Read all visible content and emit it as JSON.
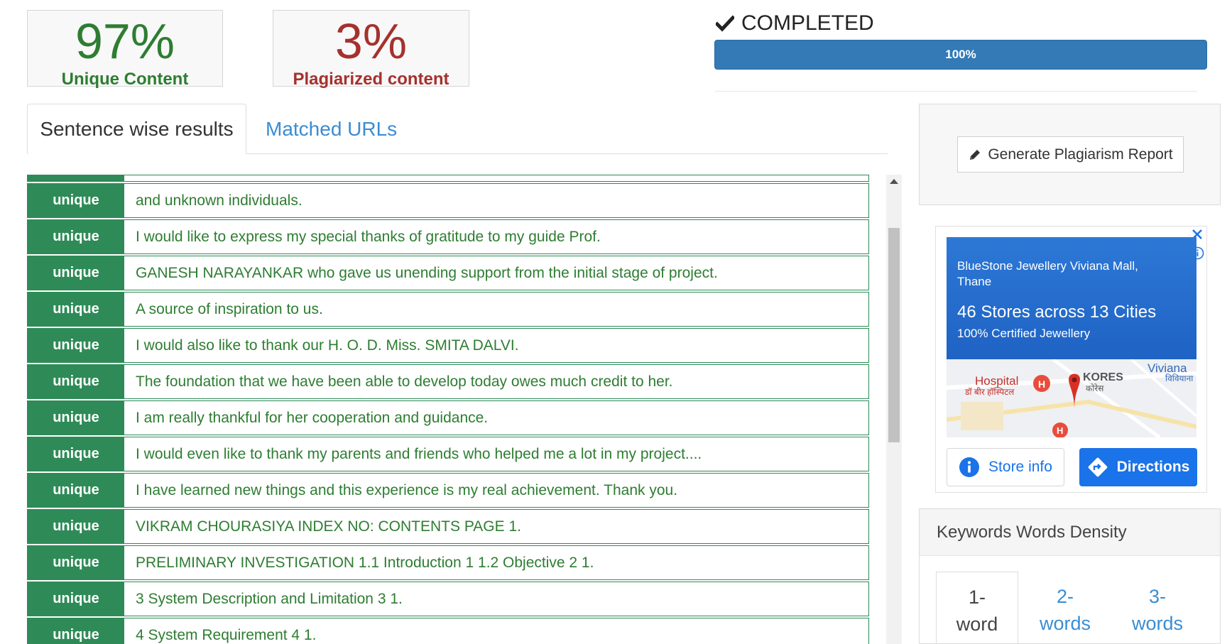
{
  "scores": {
    "unique": {
      "value": "97%",
      "label": "Unique Content",
      "color": "#2e7d32"
    },
    "plagiarized": {
      "value": "3%",
      "label": "Plagiarized content",
      "color": "#a5312d"
    }
  },
  "status": {
    "text": "COMPLETED",
    "icon": "check-icon"
  },
  "progress": {
    "percent": 100,
    "label": "100%",
    "color": "#337ab7"
  },
  "tabs": [
    {
      "label": "Sentence wise results",
      "active": true
    },
    {
      "label": "Matched URLs",
      "active": false
    }
  ],
  "results": [
    {
      "status": "unique",
      "text": "and unknown individuals."
    },
    {
      "status": "unique",
      "text": "I would like to express my special thanks of gratitude to my guide Prof."
    },
    {
      "status": "unique",
      "text": "GANESH NARAYANKAR who gave us unending support from the initial stage of project."
    },
    {
      "status": "unique",
      "text": "A source of inspiration to us."
    },
    {
      "status": "unique",
      "text": "I would also like to thank our H. O. D. Miss. SMITA DALVI."
    },
    {
      "status": "unique",
      "text": "The foundation that we have been able to develop today owes much credit to her."
    },
    {
      "status": "unique",
      "text": "I am really thankful for her cooperation and guidance."
    },
    {
      "status": "unique",
      "text": "I would even like to thank my parents and friends who helped me a lot in my project...."
    },
    {
      "status": "unique",
      "text": "I have learned new things and this experience is my real achievement. Thank you."
    },
    {
      "status": "unique",
      "text": "VIKRAM CHOURASIYA INDEX NO: CONTENTS PAGE 1."
    },
    {
      "status": "unique",
      "text": "PRELIMINARY INVESTIGATION 1.1 Introduction 1 1.2 Objective 2 1."
    },
    {
      "status": "unique",
      "text": "3 System Description and Limitation 3 1."
    },
    {
      "status": "unique",
      "text": "4 System Requirement 4 1."
    }
  ],
  "report": {
    "button_label": "Generate Plagiarism Report",
    "icon": "pencil-icon"
  },
  "ad": {
    "store": "BlueStone Jewellery Viviana Mall, Thane",
    "headline": "46 Stores across 13 Cities",
    "subline": "100% Certified Jewellery",
    "map": {
      "label_hospital": "Hospital",
      "label_hospital_hi": "डॉ बीर हॉस्पिटल",
      "label_kores": "KORES",
      "label_kores_hi": "कोरेस",
      "label_viviana": "Viviana",
      "label_viviana_hi": "विवियाना"
    },
    "store_info_label": "Store info",
    "directions_label": "Directions"
  },
  "keywords": {
    "title": "Keywords Words Density",
    "tabs": [
      {
        "line1": "1-",
        "line2": "word",
        "active": true
      },
      {
        "line1": "2-",
        "line2": "words",
        "active": false
      },
      {
        "line1": "3-",
        "line2": "words",
        "active": false
      }
    ]
  }
}
